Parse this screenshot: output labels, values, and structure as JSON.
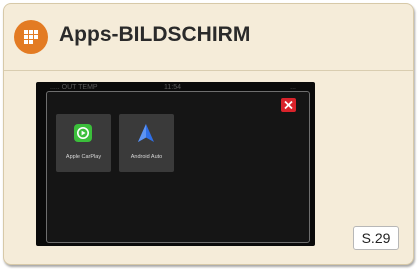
{
  "header": {
    "title": "Apps-BILDSCHIRM",
    "icon": "apps-grid-icon",
    "icon_color": "#e37b23"
  },
  "screen": {
    "status": {
      "left": "..... OUT TEMP",
      "center": "11:54",
      "right": "..."
    },
    "close_icon": "close-icon",
    "close_color": "#d9232b",
    "apps": [
      {
        "label": "Apple CarPlay",
        "icon": "carplay-icon",
        "color": "#3bbf3b"
      },
      {
        "label": "Android Auto",
        "icon": "android-auto-icon",
        "color": "#2f6fe8"
      }
    ]
  },
  "page_ref": "S.29",
  "colors": {
    "card_background": "#f5ecd9",
    "screen_background": "#0a0a0a"
  }
}
